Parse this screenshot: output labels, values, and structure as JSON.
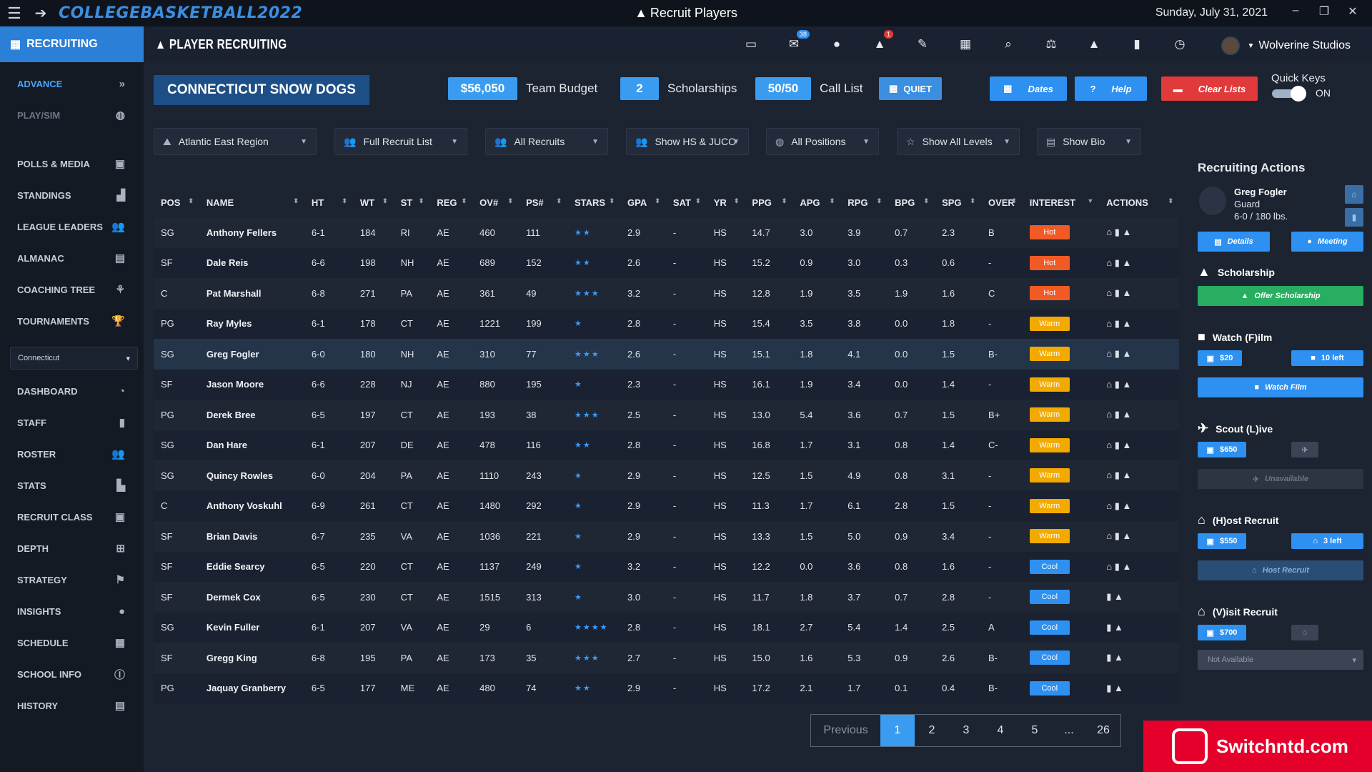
{
  "titlebar": {
    "logo": "COLLEGEBASKETBALL2022",
    "title": "Recruit Players",
    "date": "Sunday, July 31, 2021"
  },
  "sidebar": {
    "header": "RECRUITING",
    "top_items": [
      {
        "label": "ADVANCE",
        "icon": "double-chevron-right-icon",
        "glyph": "»",
        "state": "active"
      },
      {
        "label": "PLAY/SIM",
        "icon": "basketball-icon",
        "glyph": "◍",
        "state": "muted"
      }
    ],
    "items": [
      {
        "label": "POLLS & MEDIA",
        "icon": "media-icon",
        "glyph": "▣"
      },
      {
        "label": "STANDINGS",
        "icon": "bar-chart-icon",
        "glyph": "▟"
      },
      {
        "label": "LEAGUE LEADERS",
        "icon": "users-icon",
        "glyph": "👥"
      },
      {
        "label": "ALMANAC",
        "icon": "archive-icon",
        "glyph": "▤"
      },
      {
        "label": "COACHING TREE",
        "icon": "tree-icon",
        "glyph": "⚘"
      },
      {
        "label": "TOURNAMENTS",
        "icon": "trophy-icon",
        "glyph": "🏆"
      }
    ],
    "conference_select": "Connecticut",
    "items2": [
      {
        "label": "DASHBOARD",
        "icon": "gauge-icon",
        "glyph": "◔"
      },
      {
        "label": "STAFF",
        "icon": "clipboard-icon",
        "glyph": "▮"
      },
      {
        "label": "ROSTER",
        "icon": "team-icon",
        "glyph": "👥"
      },
      {
        "label": "STATS",
        "icon": "line-chart-icon",
        "glyph": "▙"
      },
      {
        "label": "RECRUIT CLASS",
        "icon": "id-badge-icon",
        "glyph": "▣"
      },
      {
        "label": "DEPTH",
        "icon": "sitemap-icon",
        "glyph": "⊞"
      },
      {
        "label": "STRATEGY",
        "icon": "strategy-icon",
        "glyph": "⚑"
      },
      {
        "label": "INSIGHTS",
        "icon": "lightbulb-icon",
        "glyph": "●"
      },
      {
        "label": "SCHEDULE",
        "icon": "calendar-icon",
        "glyph": "▦"
      },
      {
        "label": "SCHOOL INFO",
        "icon": "info-icon",
        "glyph": "ⓘ"
      },
      {
        "label": "HISTORY",
        "icon": "archive-icon",
        "glyph": "▤"
      }
    ]
  },
  "topbar": {
    "title": "PLAYER RECRUITING",
    "icons": [
      {
        "name": "briefcase-icon",
        "glyph": "▭"
      },
      {
        "name": "mail-icon",
        "glyph": "✉",
        "badge": "38"
      },
      {
        "name": "chat-icon",
        "glyph": "●"
      },
      {
        "name": "bell-icon",
        "glyph": "▲",
        "badge": "1",
        "badge_color": "red"
      },
      {
        "name": "edit-icon",
        "glyph": "✎"
      },
      {
        "name": "calendar-icon",
        "glyph": "▦"
      },
      {
        "name": "search-icon",
        "glyph": "⌕"
      },
      {
        "name": "scale-icon",
        "glyph": "⚖"
      },
      {
        "name": "recruit-logo-icon",
        "glyph": "▲"
      },
      {
        "name": "clipboard-icon",
        "glyph": "▮"
      },
      {
        "name": "stopwatch-icon",
        "glyph": "◷"
      }
    ],
    "user": "Wolverine Studios"
  },
  "summary": {
    "team": "CONNECTICUT SNOW DOGS",
    "budget_value": "$56,050",
    "budget_label": "Team Budget",
    "scholarships_value": "2",
    "scholarships_label": "Scholarships",
    "calllist_value": "50/50",
    "calllist_label": "Call List",
    "quiet_label": "QUIET",
    "dates_label": "Dates",
    "help_label": "Help",
    "clear_label": "Clear Lists",
    "quick_keys_label": "Quick Keys",
    "quick_keys_state": "ON"
  },
  "filters": [
    {
      "label": "Atlantic East Region",
      "icon": "region-icon"
    },
    {
      "label": "Full Recruit List",
      "icon": "users-icon"
    },
    {
      "label": "All Recruits",
      "icon": "users-icon"
    },
    {
      "label": "Show HS & JUCO",
      "icon": "users-icon"
    },
    {
      "label": "All Positions",
      "icon": "basketball-icon"
    },
    {
      "label": "Show All Levels",
      "icon": "star-icon"
    },
    {
      "label": "Show Bio",
      "icon": "id-card-icon"
    }
  ],
  "table": {
    "columns": [
      "POS",
      "NAME",
      "HT",
      "WT",
      "ST",
      "REG",
      "OV#",
      "PS#",
      "STARS",
      "GPA",
      "SAT",
      "YR",
      "PPG",
      "APG",
      "RPG",
      "BPG",
      "SPG",
      "OVER",
      "INTEREST",
      "ACTIONS"
    ],
    "rows": [
      {
        "pos": "SG",
        "name": "Anthony Fellers",
        "ht": "6-1",
        "wt": "184",
        "st": "RI",
        "reg": "AE",
        "ov": "460",
        "ps": "111",
        "stars": "★★",
        "gpa": "2.9",
        "sat": "-",
        "yr": "HS",
        "ppg": "14.7",
        "apg": "3.0",
        "rpg": "3.9",
        "bpg": "0.7",
        "spg": "2.3",
        "over": "B",
        "interest": "Hot",
        "level": "hot",
        "actions": "⌂ ▮ ▲"
      },
      {
        "pos": "SF",
        "name": "Dale Reis",
        "ht": "6-6",
        "wt": "198",
        "st": "NH",
        "reg": "AE",
        "ov": "689",
        "ps": "152",
        "stars": "★★",
        "gpa": "2.6",
        "sat": "-",
        "yr": "HS",
        "ppg": "15.2",
        "apg": "0.9",
        "rpg": "3.0",
        "bpg": "0.3",
        "spg": "0.6",
        "over": "-",
        "interest": "Hot",
        "level": "hot",
        "actions": "⌂ ▮ ▲"
      },
      {
        "pos": "C",
        "name": "Pat Marshall",
        "ht": "6-8",
        "wt": "271",
        "st": "PA",
        "reg": "AE",
        "ov": "361",
        "ps": "49",
        "stars": "★★★",
        "gpa": "3.2",
        "sat": "-",
        "yr": "HS",
        "ppg": "12.8",
        "apg": "1.9",
        "rpg": "3.5",
        "bpg": "1.9",
        "spg": "1.6",
        "over": "C",
        "interest": "Hot",
        "level": "hot",
        "actions": "⌂ ▮ ▲"
      },
      {
        "pos": "PG",
        "name": "Ray Myles",
        "ht": "6-1",
        "wt": "178",
        "st": "CT",
        "reg": "AE",
        "ov": "1221",
        "ps": "199",
        "stars": "★",
        "gpa": "2.8",
        "sat": "-",
        "yr": "HS",
        "ppg": "15.4",
        "apg": "3.5",
        "rpg": "3.8",
        "bpg": "0.0",
        "spg": "1.8",
        "over": "-",
        "interest": "Warm",
        "level": "warm",
        "actions": "⌂ ▮ ▲"
      },
      {
        "pos": "SG",
        "name": "Greg Fogler",
        "ht": "6-0",
        "wt": "180",
        "st": "NH",
        "reg": "AE",
        "ov": "310",
        "ps": "77",
        "stars": "★★★",
        "gpa": "2.6",
        "sat": "-",
        "yr": "HS",
        "ppg": "15.1",
        "apg": "1.8",
        "rpg": "4.1",
        "bpg": "0.0",
        "spg": "1.5",
        "over": "B-",
        "interest": "Warm",
        "level": "warm",
        "actions": "⌂ ▮ ▲",
        "selected": true
      },
      {
        "pos": "SF",
        "name": "Jason Moore",
        "ht": "6-6",
        "wt": "228",
        "st": "NJ",
        "reg": "AE",
        "ov": "880",
        "ps": "195",
        "stars": "★",
        "gpa": "2.3",
        "sat": "-",
        "yr": "HS",
        "ppg": "16.1",
        "apg": "1.9",
        "rpg": "3.4",
        "bpg": "0.0",
        "spg": "1.4",
        "over": "-",
        "interest": "Warm",
        "level": "warm",
        "actions": "⌂ ▮ ▲"
      },
      {
        "pos": "PG",
        "name": "Derek Bree",
        "ht": "6-5",
        "wt": "197",
        "st": "CT",
        "reg": "AE",
        "ov": "193",
        "ps": "38",
        "stars": "★★★",
        "gpa": "2.5",
        "sat": "-",
        "yr": "HS",
        "ppg": "13.0",
        "apg": "5.4",
        "rpg": "3.6",
        "bpg": "0.7",
        "spg": "1.5",
        "over": "B+",
        "interest": "Warm",
        "level": "warm",
        "actions": "⌂ ▮ ▲"
      },
      {
        "pos": "SG",
        "name": "Dan Hare",
        "ht": "6-1",
        "wt": "207",
        "st": "DE",
        "reg": "AE",
        "ov": "478",
        "ps": "116",
        "stars": "★★",
        "gpa": "2.8",
        "sat": "-",
        "yr": "HS",
        "ppg": "16.8",
        "apg": "1.7",
        "rpg": "3.1",
        "bpg": "0.8",
        "spg": "1.4",
        "over": "C-",
        "interest": "Warm",
        "level": "warm",
        "actions": "⌂ ▮ ▲"
      },
      {
        "pos": "SG",
        "name": "Quincy Rowles",
        "ht": "6-0",
        "wt": "204",
        "st": "PA",
        "reg": "AE",
        "ov": "1110",
        "ps": "243",
        "stars": "★",
        "gpa": "2.9",
        "sat": "-",
        "yr": "HS",
        "ppg": "12.5",
        "apg": "1.5",
        "rpg": "4.9",
        "bpg": "0.8",
        "spg": "3.1",
        "over": "-",
        "interest": "Warm",
        "level": "warm",
        "actions": "⌂ ▮ ▲"
      },
      {
        "pos": "C",
        "name": "Anthony Voskuhl",
        "ht": "6-9",
        "wt": "261",
        "st": "CT",
        "reg": "AE",
        "ov": "1480",
        "ps": "292",
        "stars": "★",
        "gpa": "2.9",
        "sat": "-",
        "yr": "HS",
        "ppg": "11.3",
        "apg": "1.7",
        "rpg": "6.1",
        "bpg": "2.8",
        "spg": "1.5",
        "over": "-",
        "interest": "Warm",
        "level": "warm",
        "actions": "⌂ ▮ ▲"
      },
      {
        "pos": "SF",
        "name": "Brian Davis",
        "ht": "6-7",
        "wt": "235",
        "st": "VA",
        "reg": "AE",
        "ov": "1036",
        "ps": "221",
        "stars": "★",
        "gpa": "2.9",
        "sat": "-",
        "yr": "HS",
        "ppg": "13.3",
        "apg": "1.5",
        "rpg": "5.0",
        "bpg": "0.9",
        "spg": "3.4",
        "over": "-",
        "interest": "Warm",
        "level": "warm",
        "actions": "⌂ ▮ ▲"
      },
      {
        "pos": "SF",
        "name": "Eddie Searcy",
        "ht": "6-5",
        "wt": "220",
        "st": "CT",
        "reg": "AE",
        "ov": "1137",
        "ps": "249",
        "stars": "★",
        "gpa": "3.2",
        "sat": "-",
        "yr": "HS",
        "ppg": "12.2",
        "apg": "0.0",
        "rpg": "3.6",
        "bpg": "0.8",
        "spg": "1.6",
        "over": "-",
        "interest": "Cool",
        "level": "cool",
        "actions": "⌂ ▮ ▲"
      },
      {
        "pos": "SF",
        "name": "Dermek Cox",
        "ht": "6-5",
        "wt": "230",
        "st": "CT",
        "reg": "AE",
        "ov": "1515",
        "ps": "313",
        "stars": "★",
        "gpa": "3.0",
        "sat": "-",
        "yr": "HS",
        "ppg": "11.7",
        "apg": "1.8",
        "rpg": "3.7",
        "bpg": "0.7",
        "spg": "2.8",
        "over": "-",
        "interest": "Cool",
        "level": "cool",
        "actions": "▮ ▲"
      },
      {
        "pos": "SG",
        "name": "Kevin Fuller",
        "ht": "6-1",
        "wt": "207",
        "st": "VA",
        "reg": "AE",
        "ov": "29",
        "ps": "6",
        "stars": "★★★★",
        "gpa": "2.8",
        "sat": "-",
        "yr": "HS",
        "ppg": "18.1",
        "apg": "2.7",
        "rpg": "5.4",
        "bpg": "1.4",
        "spg": "2.5",
        "over": "A",
        "interest": "Cool",
        "level": "cool",
        "actions": "▮ ▲"
      },
      {
        "pos": "SF",
        "name": "Gregg King",
        "ht": "6-8",
        "wt": "195",
        "st": "PA",
        "reg": "AE",
        "ov": "173",
        "ps": "35",
        "stars": "★★★",
        "gpa": "2.7",
        "sat": "-",
        "yr": "HS",
        "ppg": "15.0",
        "apg": "1.6",
        "rpg": "5.3",
        "bpg": "0.9",
        "spg": "2.6",
        "over": "B-",
        "interest": "Cool",
        "level": "cool",
        "actions": "▮ ▲"
      },
      {
        "pos": "PG",
        "name": "Jaquay Granberry",
        "ht": "6-5",
        "wt": "177",
        "st": "ME",
        "reg": "AE",
        "ov": "480",
        "ps": "74",
        "stars": "★★",
        "gpa": "2.9",
        "sat": "-",
        "yr": "HS",
        "ppg": "17.2",
        "apg": "2.1",
        "rpg": "1.7",
        "bpg": "0.1",
        "spg": "0.4",
        "over": "B-",
        "interest": "Cool",
        "level": "cool",
        "actions": "▮ ▲"
      }
    ]
  },
  "pager": {
    "prev": "Previous",
    "pages": [
      "1",
      "2",
      "3",
      "4",
      "5",
      "...",
      "26"
    ],
    "current": "1"
  },
  "actions_panel": {
    "title": "Recruiting Actions",
    "player_name": "Greg Fogler",
    "player_pos": "Guard",
    "player_meta": "6-0 / 180 lbs.",
    "details_label": "Details",
    "meeting_label": "Meeting",
    "scholarship_title": "Scholarship",
    "offer_label": "Offer Scholarship",
    "watch_title": "Watch (F)ilm",
    "watch_cost": "$20",
    "watch_left": "10 left",
    "watch_btn": "Watch Film",
    "scout_title": "Scout (L)ive",
    "scout_cost": "$650",
    "scout_btn": "Unavailable",
    "host_title": "(H)ost Recruit",
    "host_cost": "$550",
    "host_left": "3 left",
    "host_btn": "Host Recruit",
    "visit_title": "(V)isit Recruit",
    "visit_cost": "$700",
    "visit_btn": "Not Available"
  },
  "watermark": "Switchntd.com"
}
